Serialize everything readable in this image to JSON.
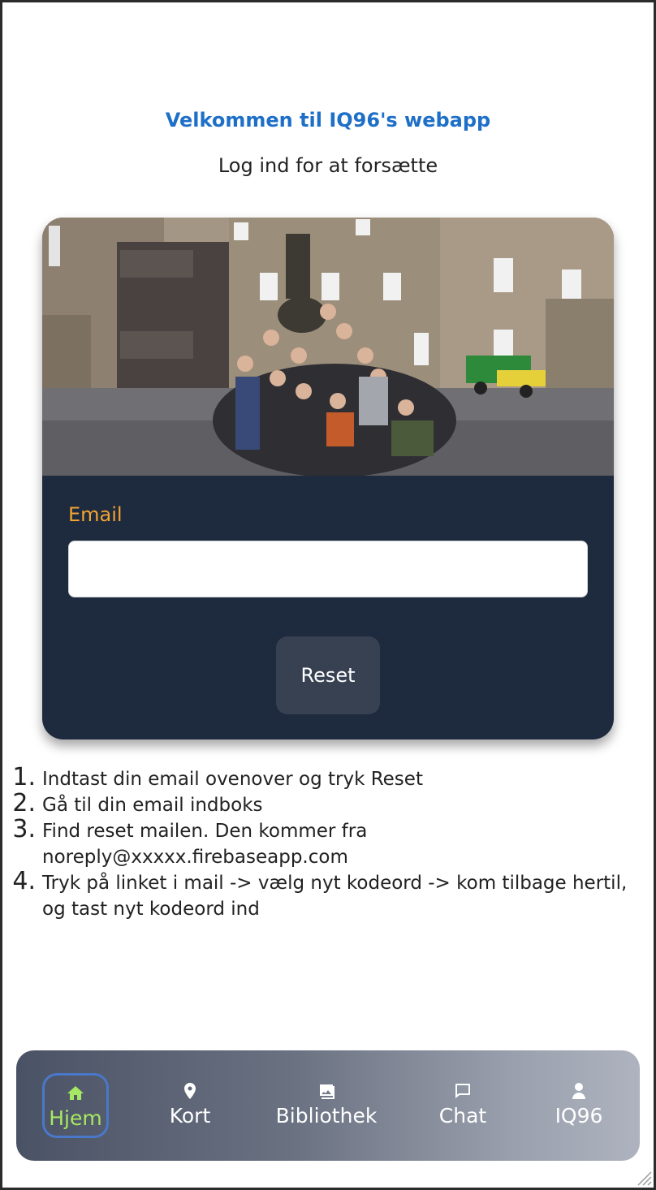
{
  "header": {
    "title": "Velkommen til IQ96's webapp",
    "subtitle": "Log ind for at forsætte"
  },
  "form": {
    "email_label": "Email",
    "email_value": "",
    "email_placeholder": "",
    "reset_label": "Reset"
  },
  "steps": [
    {
      "num": "1.",
      "text": "Indtast din email ovenover og tryk Reset"
    },
    {
      "num": "2.",
      "text": "Gå til din email indboks"
    },
    {
      "num": "3.",
      "text": "Find reset mailen. Den kommer fra noreply@xxxxx.firebaseapp.com"
    },
    {
      "num": "4.",
      "text": "Tryk på linket i mail -> vælg nyt kodeord -> kom tilbage hertil, og tast nyt kodeord ind"
    }
  ],
  "nav": {
    "items": [
      {
        "label": "Hjem",
        "icon": "home-icon",
        "active": true
      },
      {
        "label": "Kort",
        "icon": "map-pin-icon",
        "active": false
      },
      {
        "label": "Bibliothek",
        "icon": "image-gallery-icon",
        "active": false
      },
      {
        "label": "Chat",
        "icon": "chat-bubble-icon",
        "active": false
      },
      {
        "label": "IQ96",
        "icon": "user-icon",
        "active": false
      }
    ]
  },
  "colors": {
    "title": "#1e6fc7",
    "card_bg": "#1e2a3d",
    "email_label": "#f2a531",
    "reset_bg": "#374152",
    "nav_active": "#a6e861",
    "nav_active_border": "#4a78c9"
  }
}
